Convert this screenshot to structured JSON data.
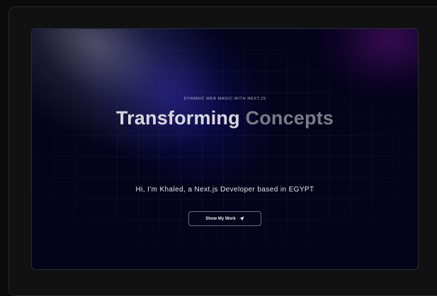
{
  "hero": {
    "eyebrow": "DYNAMIC WEB MAGIC WITH NEXT.JS",
    "headline_primary": "Transforming",
    "headline_secondary": "Concepts",
    "subtitle": "Hi, I'm Khaled, a Next.js Developer based in EGYPT",
    "cta_label": "Show My Work",
    "cta_icon": "location-arrow-icon"
  },
  "colors": {
    "background": "#03031a",
    "headline_primary": "#d8d8dc",
    "headline_secondary": "#7b7b88",
    "accent_blue": "#281ebe",
    "accent_purple": "#6e148c"
  }
}
